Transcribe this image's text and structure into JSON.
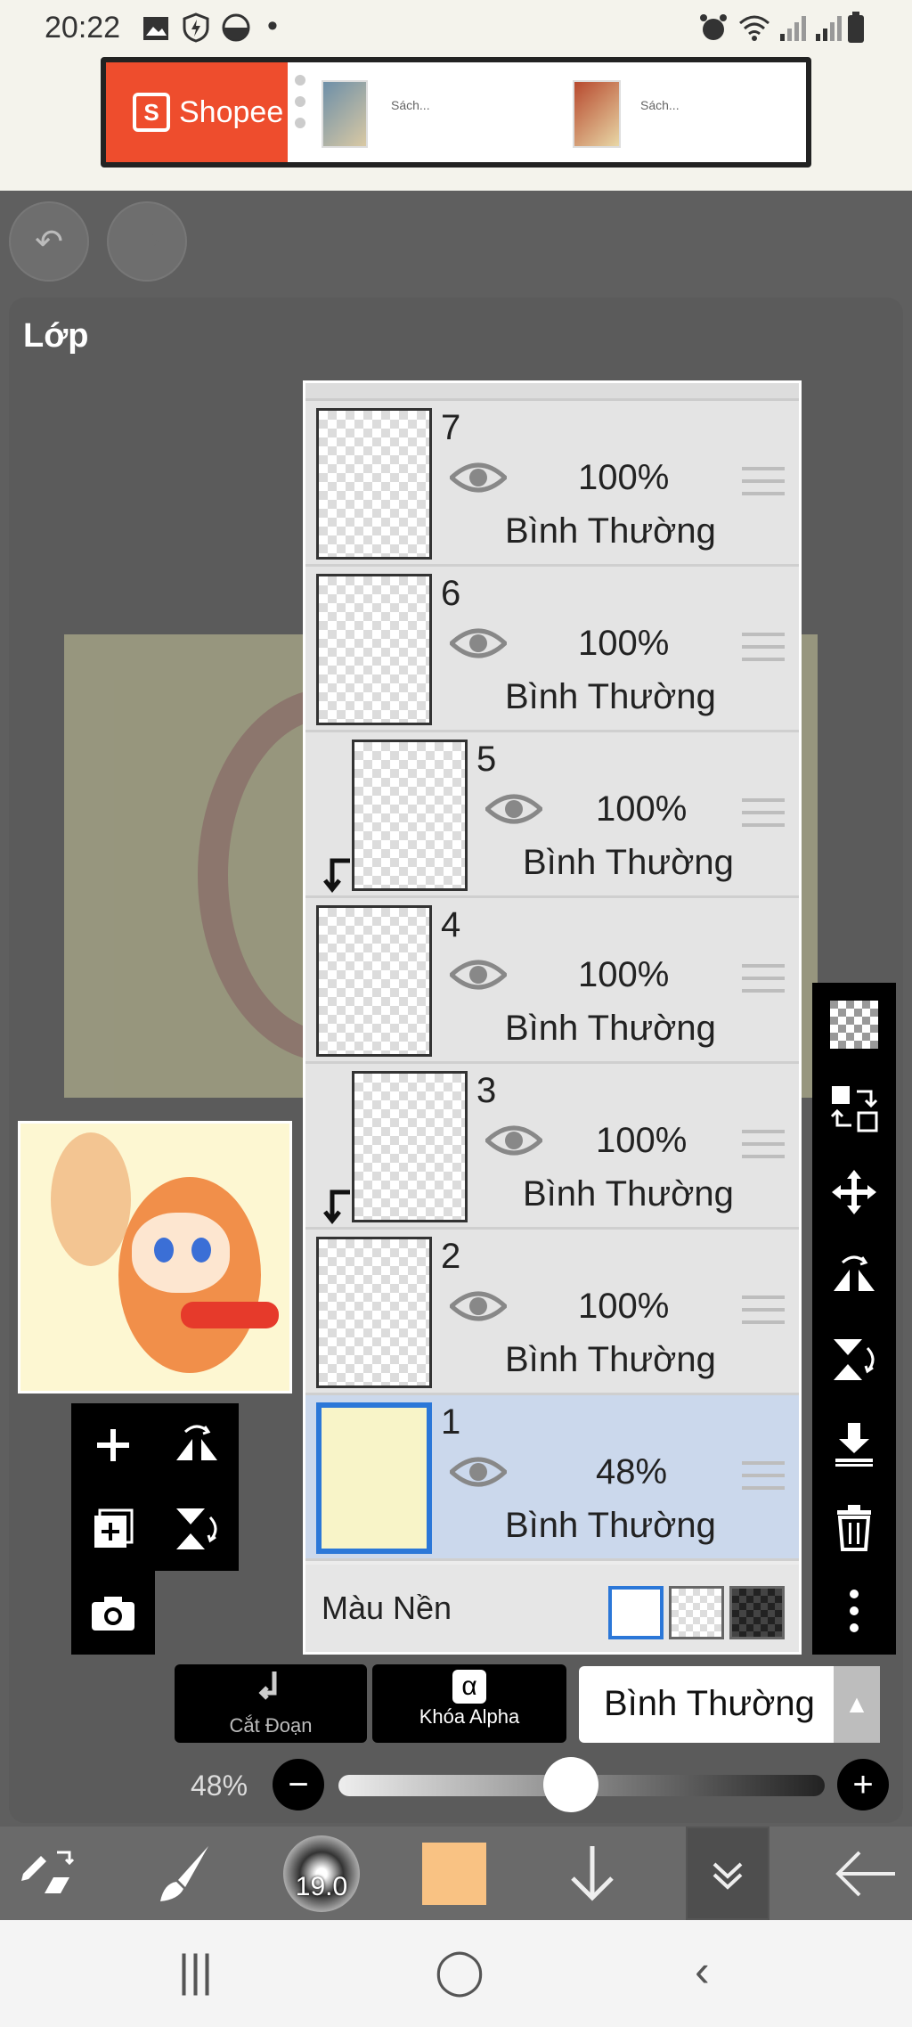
{
  "status_bar": {
    "time": "20:22",
    "dot": "•",
    "icons": [
      "gallery-icon",
      "shield-icon",
      "app-icon",
      "alarm-icon",
      "wifi-icon",
      "signal-icon",
      "signal-icon",
      "battery-icon"
    ]
  },
  "ad": {
    "brand": "Shopee",
    "brand_glyph": "S",
    "products": [
      {
        "label": "Sách..."
      },
      {
        "label": "Sách..."
      }
    ]
  },
  "toolbar_top": {
    "undo_glyph": "↶",
    "redo_glyph": "↷"
  },
  "panel": {
    "title": "Lớp"
  },
  "layers": [
    {
      "number": "7",
      "opacity": "100%",
      "mode": "Bình Thường",
      "clipped": false,
      "selected": false
    },
    {
      "number": "6",
      "opacity": "100%",
      "mode": "Bình Thường",
      "clipped": false,
      "selected": false
    },
    {
      "number": "5",
      "opacity": "100%",
      "mode": "Bình Thường",
      "clipped": true,
      "selected": false
    },
    {
      "number": "4",
      "opacity": "100%",
      "mode": "Bình Thường",
      "clipped": false,
      "selected": false
    },
    {
      "number": "3",
      "opacity": "100%",
      "mode": "Bình Thường",
      "clipped": true,
      "selected": false
    },
    {
      "number": "2",
      "opacity": "100%",
      "mode": "Bình Thường",
      "clipped": false,
      "selected": false
    },
    {
      "number": "1",
      "opacity": "48%",
      "mode": "Bình Thường",
      "clipped": false,
      "selected": true
    }
  ],
  "background_row": {
    "label": "Màu Nền",
    "swatches": [
      "white",
      "transparent",
      "dark-checker"
    ],
    "selected": "white"
  },
  "layer_controls": {
    "clipping_label": "Cắt Đoạn",
    "alpha_lock_label": "Khóa Alpha",
    "alpha_glyph": "α",
    "blend_mode": "Bình Thường",
    "blend_arrow": "▲"
  },
  "opacity": {
    "label": "48%",
    "value": 0.48,
    "minus": "−",
    "plus": "+"
  },
  "bottom_toolbar": {
    "brush_size": "19.0",
    "color": "#f9c283"
  },
  "nav": {
    "recent": "|||",
    "home": "◯",
    "back": "‹"
  }
}
